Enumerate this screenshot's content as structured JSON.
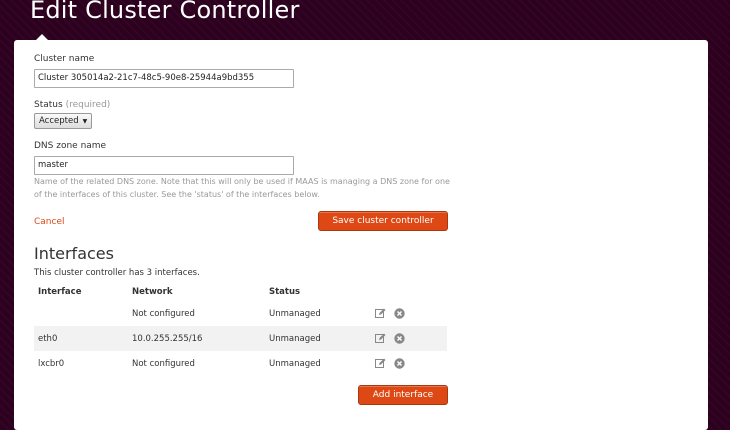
{
  "page": {
    "title": "Edit Cluster Controller"
  },
  "form": {
    "cluster_name_label": "Cluster name",
    "cluster_name_value": "Cluster 305014a2-21c7-48c5-90e8-25944a9bd355",
    "status_label": "Status",
    "status_required": "(required)",
    "status_value": "Accepted",
    "dns_zone_label": "DNS zone name",
    "dns_zone_value": "master",
    "dns_help": "Name of the related DNS zone. Note that this will only be used if MAAS is managing a DNS zone for one of the interfaces of this cluster. See the 'status' of the interfaces below.",
    "cancel_label": "Cancel",
    "save_label": "Save cluster controller"
  },
  "interfaces": {
    "title": "Interfaces",
    "summary": "This cluster controller has 3 interfaces.",
    "columns": [
      "Interface",
      "Network",
      "Status"
    ],
    "rows": [
      {
        "interface": "",
        "network": "Not configured",
        "status": "Unmanaged"
      },
      {
        "interface": "eth0",
        "network": "10.0.255.255/16",
        "status": "Unmanaged"
      },
      {
        "interface": "lxcbr0",
        "network": "Not configured",
        "status": "Unmanaged"
      }
    ],
    "add_label": "Add interface"
  },
  "colors": {
    "accent": "#dd4814",
    "background": "#2c001e"
  },
  "icons": {
    "edit": "edit-icon",
    "delete": "delete-icon",
    "dropdown": "chevron-down-icon"
  }
}
